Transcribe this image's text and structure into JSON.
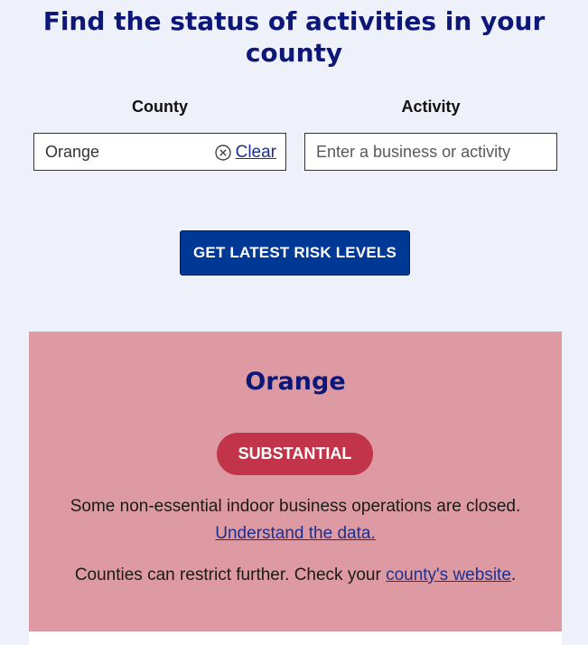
{
  "header": {
    "title": "Find the status of activities in your county"
  },
  "form": {
    "county_label": "County",
    "activity_label": "Activity",
    "county_value": "Orange",
    "clear_label": "Clear",
    "activity_placeholder": "Enter a business or activity",
    "submit_label": "GET LATEST RISK LEVELS"
  },
  "result": {
    "county_name": "Orange",
    "tier": "SUBSTANTIAL",
    "tier_color": "#c1344a",
    "card_color": "#de9aa2",
    "description": "Some non-essential indoor business operations are closed.",
    "understand_link": "Understand the data.",
    "restrict_prefix": "Counties can restrict further. Check your ",
    "county_website_link": "county's website",
    "restrict_suffix": "."
  },
  "icons": {
    "clear": "close-circle-icon"
  },
  "colors": {
    "heading": "#0c1777",
    "button": "#003896",
    "link": "#1e2f8c",
    "background": "#eef1fa"
  }
}
